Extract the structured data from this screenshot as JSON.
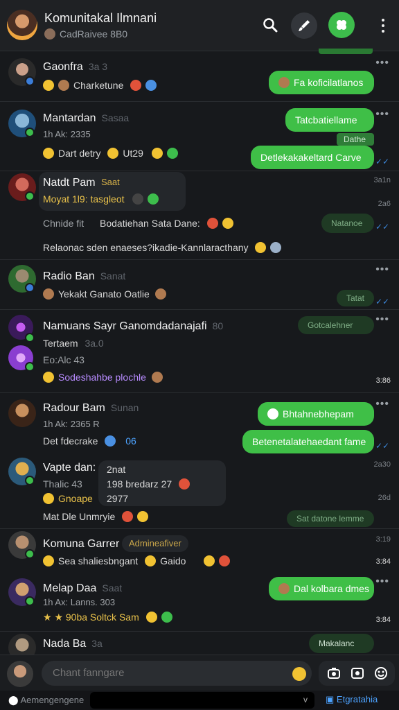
{
  "header": {
    "title": "Komunitakal Ilmnani",
    "subtitle": "CadRaivee 8B0"
  },
  "chats": [
    {
      "name": "Gaonfra",
      "name_muted": "3a 3",
      "preview": "Charketune",
      "bubble": "Fa koficilatlanos"
    },
    {
      "name": "Mantardan",
      "name_muted": "Sasaa",
      "line2": "1h Ak: 2335",
      "preview": "Dart detry",
      "preview_tail": "Ut29",
      "bubble1": "Tatcbatiellame",
      "bubble2": "Dathe",
      "bubble3": "Detlekakakeltard Carve"
    },
    {
      "name": "Natdt Pam",
      "tag": "Saat",
      "line2": "Moyat 1l9: tasgleot",
      "time": "3a1n"
    },
    {
      "text1": "Chnide fit",
      "text1b": "Bodatiehan Sata Dane:",
      "time": "2a6",
      "dark_bubble": "Natanoe"
    },
    {
      "text": "Relaonac sden enaeses?ikadie-Kannlaracthany"
    },
    {
      "name": "Radio Ban",
      "name_muted": "Sanat",
      "preview": "Yekakt Ganato Oatlie",
      "dark_bubble": "Tatat"
    },
    {
      "name": "Namuans Sayr Ganomdadanajafi",
      "name_muted": "80",
      "line2": "Tertaem",
      "line2_muted": "3a.0",
      "line3": "Eo:Alc 43",
      "preview": "Sodeshahbe plochle",
      "dark_bubble": "Gotcalehner",
      "time": "3:86"
    },
    {
      "name": "Radour Bam",
      "name_muted": "Sunan",
      "line2": "1h Ak: 2365 R",
      "preview": "Det fdecrake",
      "preview_tail": "06",
      "bubble1": "Bhtahnebhepam",
      "bubble2": "Betenetalatehaedant fame"
    },
    {
      "name": "Vapte dan:",
      "line2": "Thalic 43",
      "preview": "Gnoape",
      "popup_title": "2nat",
      "popup_line": "198 bredarz 27",
      "popup_num": "2977",
      "line4": "Mat Dle Unmryie",
      "dark_bubble": "Sat datone lemme",
      "time": "2a30",
      "time2": "26d"
    },
    {
      "name": "Komuna Garrer",
      "tag": "Admineafiver",
      "preview": "Sea shaliesbngant",
      "preview_tail": "Gaido",
      "time": "3:19",
      "time2": "3:84"
    },
    {
      "name": "Melap Daa",
      "name_muted": "Saat",
      "line2": "1h Ax: Lanns. 303",
      "preview": "90ba Soltck Sam",
      "bubble": "Dal kolbara dmes",
      "time": "3:84"
    },
    {
      "name": "Nada Ba",
      "name_muted": "3a",
      "dark_bubble": "Makalanc"
    }
  ],
  "composer": {
    "placeholder": "Chant fanngare",
    "bottom_left": "Aemengengene",
    "bottom_right": "Etgratahia"
  }
}
